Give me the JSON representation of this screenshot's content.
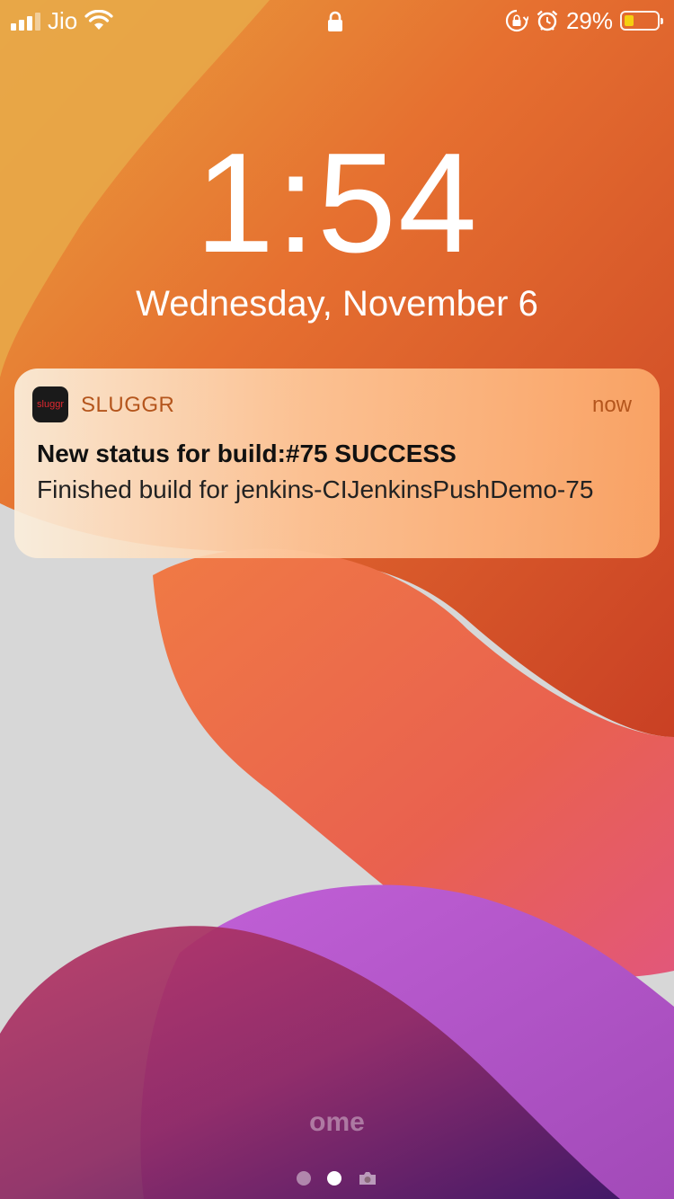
{
  "status_bar": {
    "carrier": "Jio",
    "signal_bars_active": 3,
    "signal_bars_total": 4,
    "battery_percent": "29%",
    "battery_level": 0.29,
    "battery_color": "#f5d010",
    "icons": [
      "signal-icon",
      "wifi-icon",
      "lock-icon",
      "rotation-lock-icon",
      "alarm-icon",
      "battery-icon"
    ]
  },
  "lockscreen": {
    "time": "1:54",
    "date": "Wednesday, November 6"
  },
  "notification": {
    "app_icon_text": "sluggr",
    "app_name": "SLUGGR",
    "time": "now",
    "title": "New status for build:#75 SUCCESS",
    "body": "Finished build for jenkins-CIJenkinsPushDemo-75"
  },
  "footer": {
    "unlock_hint": "ome",
    "page_dots": 2,
    "active_dot_index": 1,
    "camera_icon": "camera-icon"
  }
}
